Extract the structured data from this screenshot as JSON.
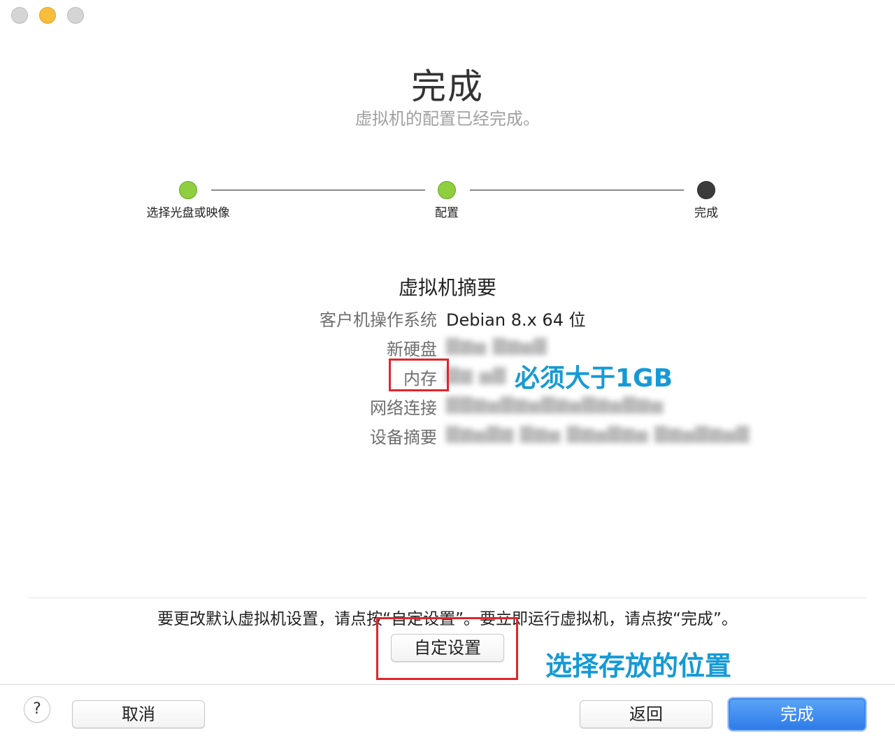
{
  "window": {
    "title": "完成",
    "subtitle": "虚拟机的配置已经完成。"
  },
  "steps": [
    {
      "label": "选择光盘或映像",
      "state": "done"
    },
    {
      "label": "配置",
      "state": "done"
    },
    {
      "label": "完成",
      "state": "current"
    }
  ],
  "summary": {
    "title": "虚拟机摘要",
    "rows": [
      {
        "label": "客户机操作系统",
        "value": "Debian 8.x 64 位"
      },
      {
        "label": "新硬盘",
        "value": "▇▆▅ ▇▆▅▇",
        "redacted": true
      },
      {
        "label": "内存",
        "value": "▇▆ ▅▇",
        "redacted": true
      },
      {
        "label": "网络连接",
        "value": "▇▇▆▅▇▆▅▇▆▅▇▆▅▇▆▅",
        "redacted": true
      },
      {
        "label": "设备摘要",
        "value": "▇▆▅▇▆ ▇▆▅ ▇▆▅▇▆▅ ▇▆▅▇▆▅▇",
        "redacted": true
      }
    ]
  },
  "annotations": {
    "memory_note": "必须大于1GB",
    "location_note": "选择存放的位置"
  },
  "hint": "要更改默认虚拟机设置，请点按“自定设置”。要立即运行虚拟机，请点按“完成”。",
  "buttons": {
    "customize": "自定设置",
    "help": "?",
    "cancel": "取消",
    "back": "返回",
    "finish": "完成"
  },
  "colors": {
    "step_done": "#8fce3f",
    "step_current": "#3b3b3b",
    "annotation": "#159ad6",
    "highlight_box": "#e0262c",
    "primary_button": "#2f7ce9"
  }
}
